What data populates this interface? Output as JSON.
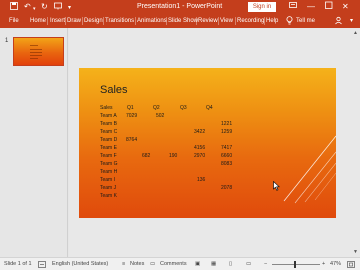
{
  "titlebar": {
    "title": "Presentation1 - PowerPoint",
    "signin_label": "Sign in",
    "icons": [
      "save-icon",
      "undo-icon",
      "redo-icon",
      "present-icon",
      "customize-icon",
      "ribbon-display-icon",
      "minimize-icon",
      "maximize-icon",
      "close-icon"
    ]
  },
  "ribbon": {
    "tabs": [
      "File",
      "Home",
      "Insert",
      "Draw",
      "Design",
      "Transitions",
      "Animations",
      "Slide Show",
      "Review",
      "View",
      "Recording",
      "Help"
    ],
    "tell_me": "Tell me",
    "icons": [
      "lightbulb-icon",
      "share-icon",
      "collapse-ribbon-icon"
    ]
  },
  "thumbnails": [
    {
      "number": "1"
    }
  ],
  "slide": {
    "title": "Sales",
    "table": {
      "header": [
        "Sales",
        "Q1",
        "Q2",
        "Q3",
        "Q4"
      ],
      "rows": [
        {
          "team": "Team A",
          "q1": "7029",
          "q2": "502",
          "q3": "",
          "q4": ""
        },
        {
          "team": "Team B",
          "q1": "",
          "q2": "",
          "q3": "",
          "q4": "1221"
        },
        {
          "team": "Team C",
          "q1": "",
          "q2": "",
          "q3": "3422",
          "q4": "1259"
        },
        {
          "team": "Team D",
          "q1": "8764",
          "q2": "",
          "q3": "",
          "q4": ""
        },
        {
          "team": "Team E",
          "q1": "",
          "q2": "",
          "q3": "4156",
          "q4": "7417"
        },
        {
          "team": "Team F",
          "q1": "682",
          "q2": "190",
          "q3": "2970",
          "q4": "6660"
        },
        {
          "team": "Team G",
          "q1": "",
          "q2": "",
          "q3": "",
          "q4": "8083"
        },
        {
          "team": "Team H",
          "q1": "",
          "q2": "",
          "q3": "",
          "q4": ""
        },
        {
          "team": "Team I",
          "q1": "",
          "q2": "",
          "q3": "136",
          "q4": ""
        },
        {
          "team": "Team J",
          "q1": "",
          "q2": "",
          "q3": "",
          "q4": "2078"
        },
        {
          "team": "Team K",
          "q1": "",
          "q2": "",
          "q3": "",
          "q4": ""
        }
      ]
    }
  },
  "statusbar": {
    "slide_info": "Slide 1 of 1",
    "language": "English (United States)",
    "notes": "Notes",
    "comments": "Comments",
    "zoom_minus": "−",
    "zoom_plus": "+",
    "zoom": "47%",
    "zoom_fraction": 0.47,
    "icons": [
      "accessibility-icon",
      "notes-icon",
      "comments-icon",
      "normal-view-icon",
      "slide-sorter-icon",
      "reading-view-icon",
      "slideshow-icon",
      "fit-slide-icon"
    ]
  },
  "colors": {
    "accent": "#c43e1c",
    "slide_top": "#f5b21a",
    "slide_bottom": "#e04a0c"
  }
}
